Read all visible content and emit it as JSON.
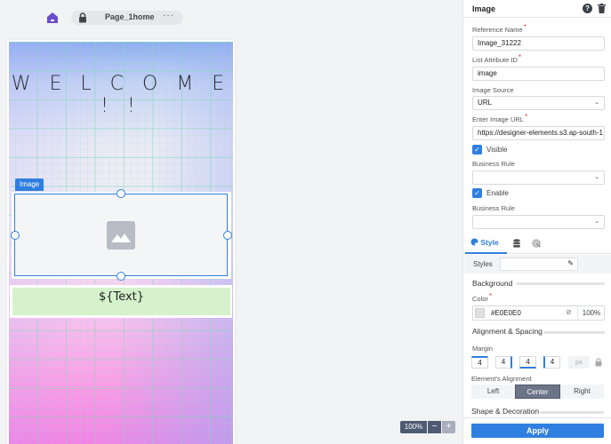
{
  "topbar": {
    "page_name": "Page_1home",
    "more_label": "···"
  },
  "canvas": {
    "welcome_text": "W E L C O M E ! !",
    "selected_tag": "Image",
    "text_component": "${Text}"
  },
  "zoom": {
    "level": "100%",
    "minus": "−",
    "plus": "+"
  },
  "panel": {
    "title": "Image",
    "help_glyph": "?",
    "fields": {
      "reference_name": {
        "label": "Reference Name",
        "value": "Image_31222",
        "required": true
      },
      "list_attribute_id": {
        "label": "List Attribute ID",
        "value": "image",
        "required": true
      },
      "image_source": {
        "label": "Image Source",
        "value": "URL"
      },
      "image_url": {
        "label": "Enter Image URL",
        "value": "https://designer-elements.s3.ap-south-1",
        "required": true
      },
      "visible": {
        "label": "Visible",
        "checked": true
      },
      "business_rule_1": {
        "label": "Business Rule",
        "value": ""
      },
      "enable": {
        "label": "Enable",
        "checked": true
      },
      "business_rule_2": {
        "label": "Business Rule",
        "value": ""
      }
    },
    "tabs": {
      "style": "Style"
    },
    "styles_label": "Styles",
    "background": {
      "heading": "Background",
      "color_label": "Color",
      "color_value": "#E0E0E0",
      "swatch": "#E0E0E0",
      "opacity": "100%"
    },
    "alignment_spacing": {
      "heading": "Alignment & Spacing",
      "margin_label": "Margin",
      "margin": [
        "4",
        "4",
        "4",
        "4"
      ],
      "unit": "px",
      "alignment_label": "Element's Alignment",
      "alignment_options": [
        "Left",
        "Center",
        "Right"
      ],
      "alignment_selected": "Center"
    },
    "shape_heading": "Shape & Decoration",
    "apply_label": "Apply"
  },
  "colors": {
    "accent": "#2F7FE0",
    "text_bg": "#D5F2CC",
    "home_icon": "#6A4FC8"
  }
}
